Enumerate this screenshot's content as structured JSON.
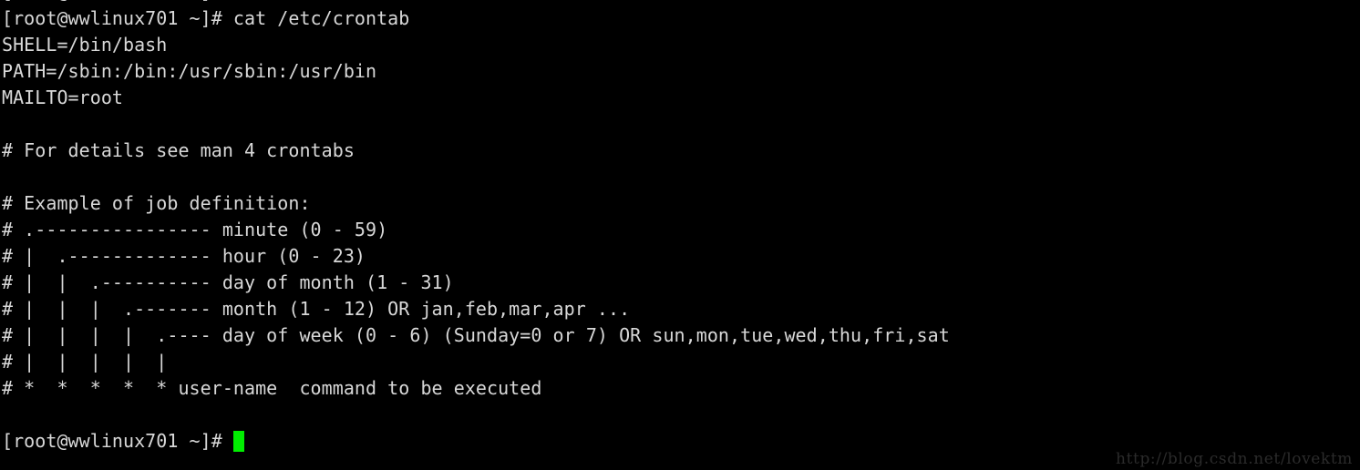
{
  "terminal": {
    "background_color": "#000000",
    "text_color": "#d8d8d8",
    "cursor_color": "#00ee00",
    "scrollback_cut_line": "[root@wwlinux701 ~]# cat /etc/crontab",
    "lines": [
      "[root@wwlinux701 ~]# cat /etc/crontab",
      "SHELL=/bin/bash",
      "PATH=/sbin:/bin:/usr/sbin:/usr/bin",
      "MAILTO=root",
      "",
      "# For details see man 4 crontabs",
      "",
      "# Example of job definition:",
      "# .---------------- minute (0 - 59)",
      "# |  .------------- hour (0 - 23)",
      "# |  |  .---------- day of month (1 - 31)",
      "# |  |  |  .------- month (1 - 12) OR jan,feb,mar,apr ...",
      "# |  |  |  |  .---- day of week (0 - 6) (Sunday=0 or 7) OR sun,mon,tue,wed,thu,fri,sat",
      "# |  |  |  |  |",
      "# *  *  *  *  * user-name  command to be executed",
      ""
    ],
    "prompt": {
      "text": "[root@wwlinux701 ~]# ",
      "cursor_visible": true
    }
  },
  "watermark": {
    "text": "http://blog.csdn.net/lovektm",
    "color": "#2b2b2b"
  }
}
